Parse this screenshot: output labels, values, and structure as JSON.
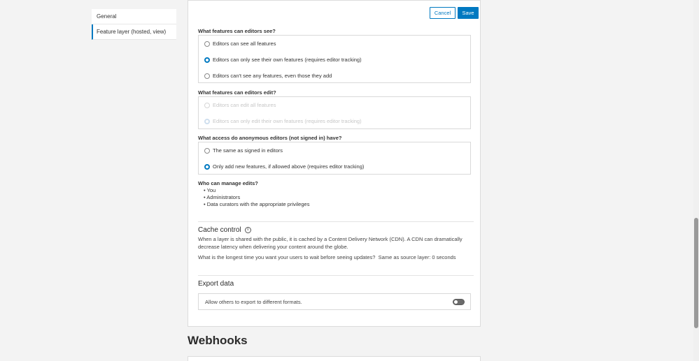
{
  "sidenav": {
    "items": [
      {
        "label": "General"
      },
      {
        "label": "Feature layer (hosted, view)"
      }
    ]
  },
  "actions": {
    "cancel_label": "Cancel",
    "save_label": "Save"
  },
  "editors_see": {
    "label": "What features can editors see?",
    "options": [
      {
        "label": "Editors can see all features",
        "checked": false
      },
      {
        "label": "Editors can only see their own features (requires editor tracking)",
        "checked": true
      },
      {
        "label": "Editors can't see any features, even those they add",
        "checked": false
      }
    ]
  },
  "editors_edit": {
    "label": "What features can editors edit?",
    "options": [
      {
        "label": "Editors can edit all features",
        "checked": false,
        "disabled": true
      },
      {
        "label": "Editors can only edit their own features (requires editor tracking)",
        "checked": true,
        "disabled": true
      }
    ]
  },
  "anon_access": {
    "label": "What access do anonymous editors (not signed in) have?",
    "options": [
      {
        "label": "The same as signed in editors",
        "checked": false
      },
      {
        "label": "Only add new features, if allowed above (requires editor tracking)",
        "checked": true
      }
    ]
  },
  "manage_edits": {
    "label": "Who can manage edits?",
    "items": [
      "• You",
      "• Administrators",
      "• Data curators with the appropriate privileges"
    ]
  },
  "cache": {
    "title": "Cache control",
    "info_glyph": "i",
    "description": "When a layer is shared with the public, it is cached by a Content Delivery Network (CDN). A CDN can dramatically decrease latency when delivering your content around the globe.",
    "question": "What is the longest time you want your users to wait before seeing updates?",
    "value": "Same as source layer: 0 seconds"
  },
  "export": {
    "title": "Export data",
    "toggle_label": "Allow others to export to different formats.",
    "enabled": false
  },
  "webhooks": {
    "title": "Webhooks"
  }
}
